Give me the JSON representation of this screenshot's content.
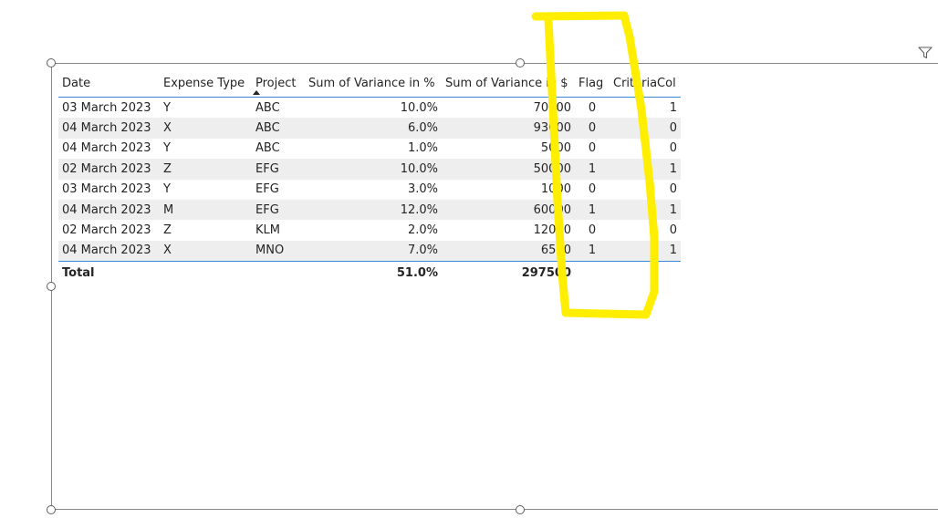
{
  "table": {
    "headers": {
      "date": "Date",
      "expense_type": "Expense Type",
      "project": "Project",
      "sum_var_pct": "Sum of Variance in %",
      "sum_var_dollar": "Sum of Variance in $",
      "flag": "Flag",
      "criteria": "CriteriaCol"
    },
    "sort": {
      "column": "Project",
      "direction": "ascending"
    },
    "rows": [
      {
        "date": "03 March 2023",
        "expense_type": "Y",
        "project": "ABC",
        "sum_var_pct": "10.0%",
        "sum_var_dollar": "70000",
        "flag": "0",
        "criteria": "1"
      },
      {
        "date": "04 March 2023",
        "expense_type": "X",
        "project": "ABC",
        "sum_var_pct": "6.0%",
        "sum_var_dollar": "93000",
        "flag": "0",
        "criteria": "0"
      },
      {
        "date": "04 March 2023",
        "expense_type": "Y",
        "project": "ABC",
        "sum_var_pct": "1.0%",
        "sum_var_dollar": "5000",
        "flag": "0",
        "criteria": "0"
      },
      {
        "date": "02 March 2023",
        "expense_type": "Z",
        "project": "EFG",
        "sum_var_pct": "10.0%",
        "sum_var_dollar": "50000",
        "flag": "1",
        "criteria": "1"
      },
      {
        "date": "03 March 2023",
        "expense_type": "Y",
        "project": "EFG",
        "sum_var_pct": "3.0%",
        "sum_var_dollar": "1000",
        "flag": "0",
        "criteria": "0"
      },
      {
        "date": "04 March 2023",
        "expense_type": "M",
        "project": "EFG",
        "sum_var_pct": "12.0%",
        "sum_var_dollar": "60000",
        "flag": "1",
        "criteria": "1"
      },
      {
        "date": "02 March 2023",
        "expense_type": "Z",
        "project": "KLM",
        "sum_var_pct": "2.0%",
        "sum_var_dollar": "12000",
        "flag": "0",
        "criteria": "0"
      },
      {
        "date": "04 March 2023",
        "expense_type": "X",
        "project": "MNO",
        "sum_var_pct": "7.0%",
        "sum_var_dollar": "6500",
        "flag": "1",
        "criteria": "1"
      }
    ],
    "total": {
      "label": "Total",
      "sum_var_pct": "51.0%",
      "sum_var_dollar": "297500"
    }
  },
  "icons": {
    "filter": "filter-icon",
    "sort": "sort-ascending-icon"
  },
  "colors": {
    "header_rule": "#3a89d9",
    "banded_row": "#eeeeee",
    "highlight_annotation": "#ffee00"
  }
}
